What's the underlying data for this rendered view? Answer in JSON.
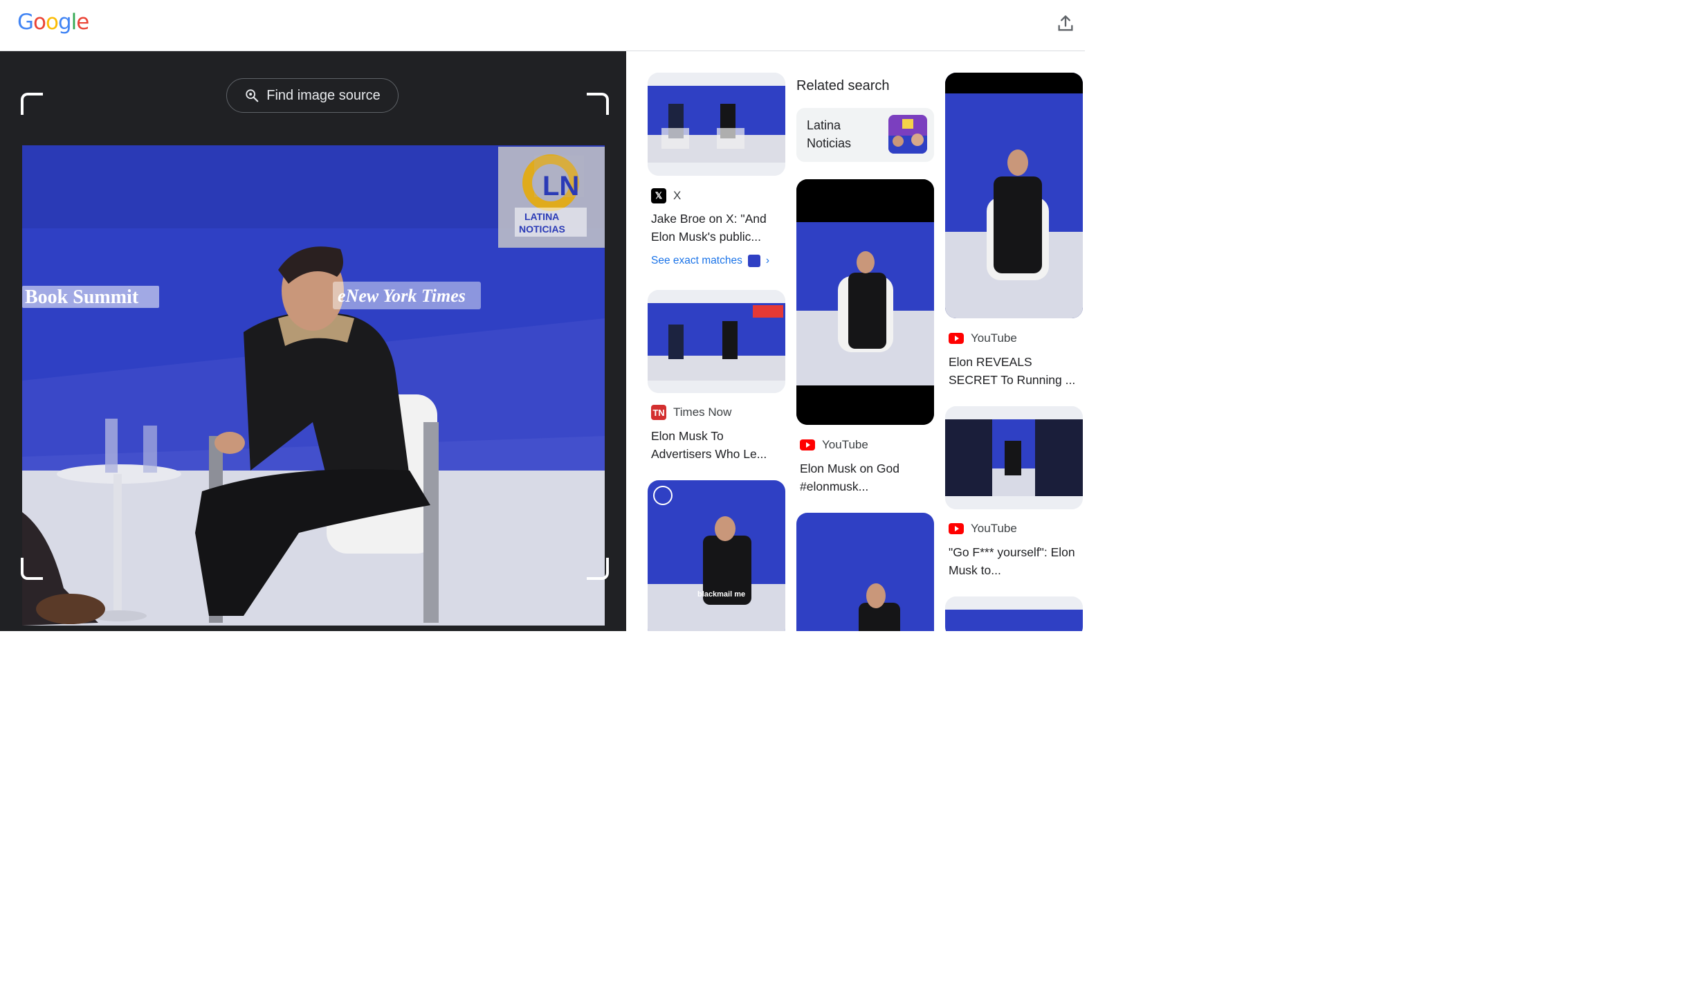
{
  "header": {
    "logo_letters": [
      {
        "ch": "G",
        "color": "#4285F4"
      },
      {
        "ch": "o",
        "color": "#EA4335"
      },
      {
        "ch": "o",
        "color": "#FBBC05"
      },
      {
        "ch": "g",
        "color": "#4285F4"
      },
      {
        "ch": "l",
        "color": "#34A853"
      },
      {
        "ch": "e",
        "color": "#EA4335"
      }
    ],
    "upload_icon": "upload-icon"
  },
  "lens": {
    "find_source_label": "Find image source",
    "image_overlay": {
      "left_banner": "Book Summit",
      "right_banner": "eNew York Times",
      "logo_text_1": "LATINA",
      "logo_text_2": "NOTICIAS",
      "logo_mark": "LN"
    }
  },
  "results": {
    "col1": [
      {
        "source": "X",
        "title": "Jake Broe on X: \"And Elon Musk's public...",
        "see_exact": "See exact matches"
      },
      {
        "source": "Times Now",
        "title": "Elon Musk To Advertisers Who Le..."
      },
      {
        "overlay_caption": "blackmail me"
      }
    ],
    "related": {
      "heading": "Related search",
      "chip_label": "Latina Noticias"
    },
    "col2": [
      {
        "source": "YouTube",
        "title": "Elon Musk on God #elonmusk..."
      }
    ],
    "col3": [
      {
        "source": "YouTube",
        "title": "Elon REVEALS SECRET To Running ..."
      },
      {
        "source": "YouTube",
        "title": "\"Go F*** yourself\": Elon Musk to..."
      }
    ]
  },
  "colors": {
    "accent": "#1a73e8",
    "youtube": "#ff0000",
    "stage_blue": "#2e3fc4"
  }
}
